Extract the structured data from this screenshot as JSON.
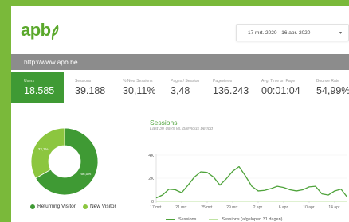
{
  "header": {
    "logo_text": "apb",
    "date_range": "17 mrt. 2020 - 16 apr. 2020",
    "date_caret": "▾"
  },
  "urlbar": {
    "url": "http://www.apb.be"
  },
  "metrics": [
    {
      "label": "Users",
      "value": "18.585"
    },
    {
      "label": "Sessions",
      "value": "39.188"
    },
    {
      "label": "% New Sessions",
      "value": "30,11%"
    },
    {
      "label": "Pages / Session",
      "value": "3,48"
    },
    {
      "label": "Pageviews",
      "value": "136.243"
    },
    {
      "label": "Avg. Time on Page",
      "value": "00:01:04"
    },
    {
      "label": "Bounce Rate",
      "value": "54,99%"
    }
  ],
  "pie": {
    "slices": [
      {
        "label": "Returning Visitor",
        "pct_label": "66,0%",
        "value": 66.0,
        "color": "#3f9a34"
      },
      {
        "label": "New Visitor",
        "pct_label": "33,1%",
        "value": 33.1,
        "color": "#8cc63f"
      }
    ]
  },
  "sessions_panel": {
    "title": "Sessions",
    "subtitle": "Last 30 days vs. previous period"
  },
  "chart_data": {
    "type": "line",
    "title": "Sessions",
    "subtitle": "Last 30 days vs. previous period",
    "ylim": [
      0,
      4000
    ],
    "yticks": [
      "0",
      "2K",
      "4K"
    ],
    "xticks": [
      "17 mrt.",
      "21 mrt.",
      "25 mrt.",
      "29 mrt.",
      "2 apr.",
      "6 apr.",
      "10 apr.",
      "14 apr."
    ],
    "series": [
      {
        "name": "Sessions",
        "color": "#4fa33b",
        "values": [
          300,
          550,
          1050,
          1000,
          750,
          1400,
          2100,
          2550,
          2500,
          2100,
          1400,
          1950,
          2600,
          3000,
          2200,
          1300,
          900,
          950,
          1100,
          1300,
          1200,
          1000,
          900,
          1000,
          1250,
          1300,
          650,
          550,
          900,
          1050,
          350
        ]
      },
      {
        "name": "Sessions (afgelopen 31 dagen)",
        "color": "#bfe3a3",
        "values": [
          0,
          0,
          0,
          0,
          0,
          0,
          0,
          0,
          0,
          0,
          0,
          0,
          0,
          0,
          0,
          0,
          0,
          0,
          0,
          0,
          0,
          0,
          0,
          0,
          0,
          0,
          0,
          0,
          0,
          0,
          0
        ]
      }
    ]
  }
}
